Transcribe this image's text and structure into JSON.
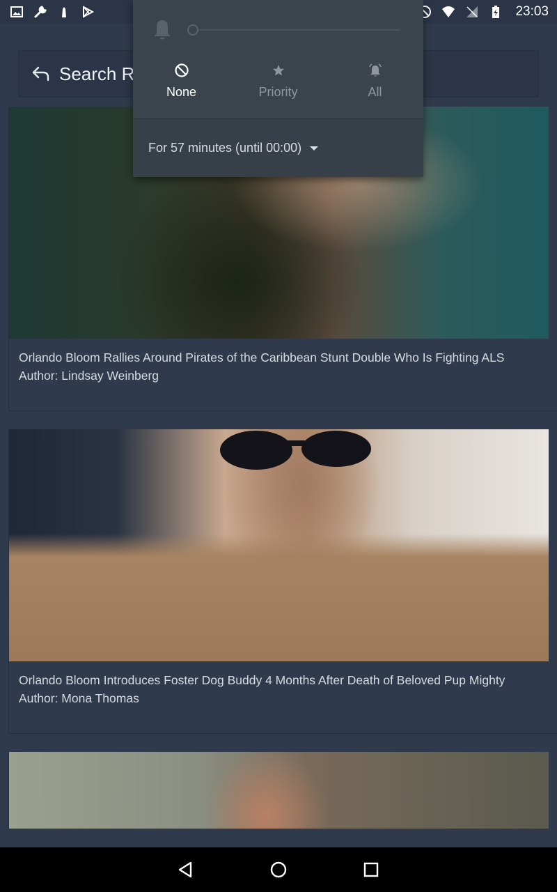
{
  "status_bar": {
    "time": "23:03",
    "left_icons": [
      "image-icon",
      "wrench-icon",
      "tower-icon",
      "play-store-icon"
    ],
    "right_icons": [
      "dnd-icon",
      "wifi-icon",
      "no-signal-icon",
      "battery-icon"
    ]
  },
  "search": {
    "text": "Search R"
  },
  "dnd": {
    "options": [
      {
        "label": "None",
        "icon": "block-icon",
        "selected": true
      },
      {
        "label": "Priority",
        "icon": "star-icon",
        "selected": false
      },
      {
        "label": "All",
        "icon": "alarm-bell-icon",
        "selected": false
      }
    ],
    "duration": "For 57 minutes (until 00:00)"
  },
  "articles": [
    {
      "title": "Orlando Bloom Rallies Around Pirates of the Caribbean Stunt Double Who Is Fighting ALS",
      "author": "Author: Lindsay Weinberg"
    },
    {
      "title": "Orlando Bloom Introduces Foster Dog Buddy 4 Months After Death of Beloved Pup Mighty",
      "author": "Author: Mona Thomas"
    },
    {
      "title": "",
      "author": ""
    }
  ],
  "nav": [
    "back-icon",
    "home-icon",
    "recents-icon"
  ]
}
